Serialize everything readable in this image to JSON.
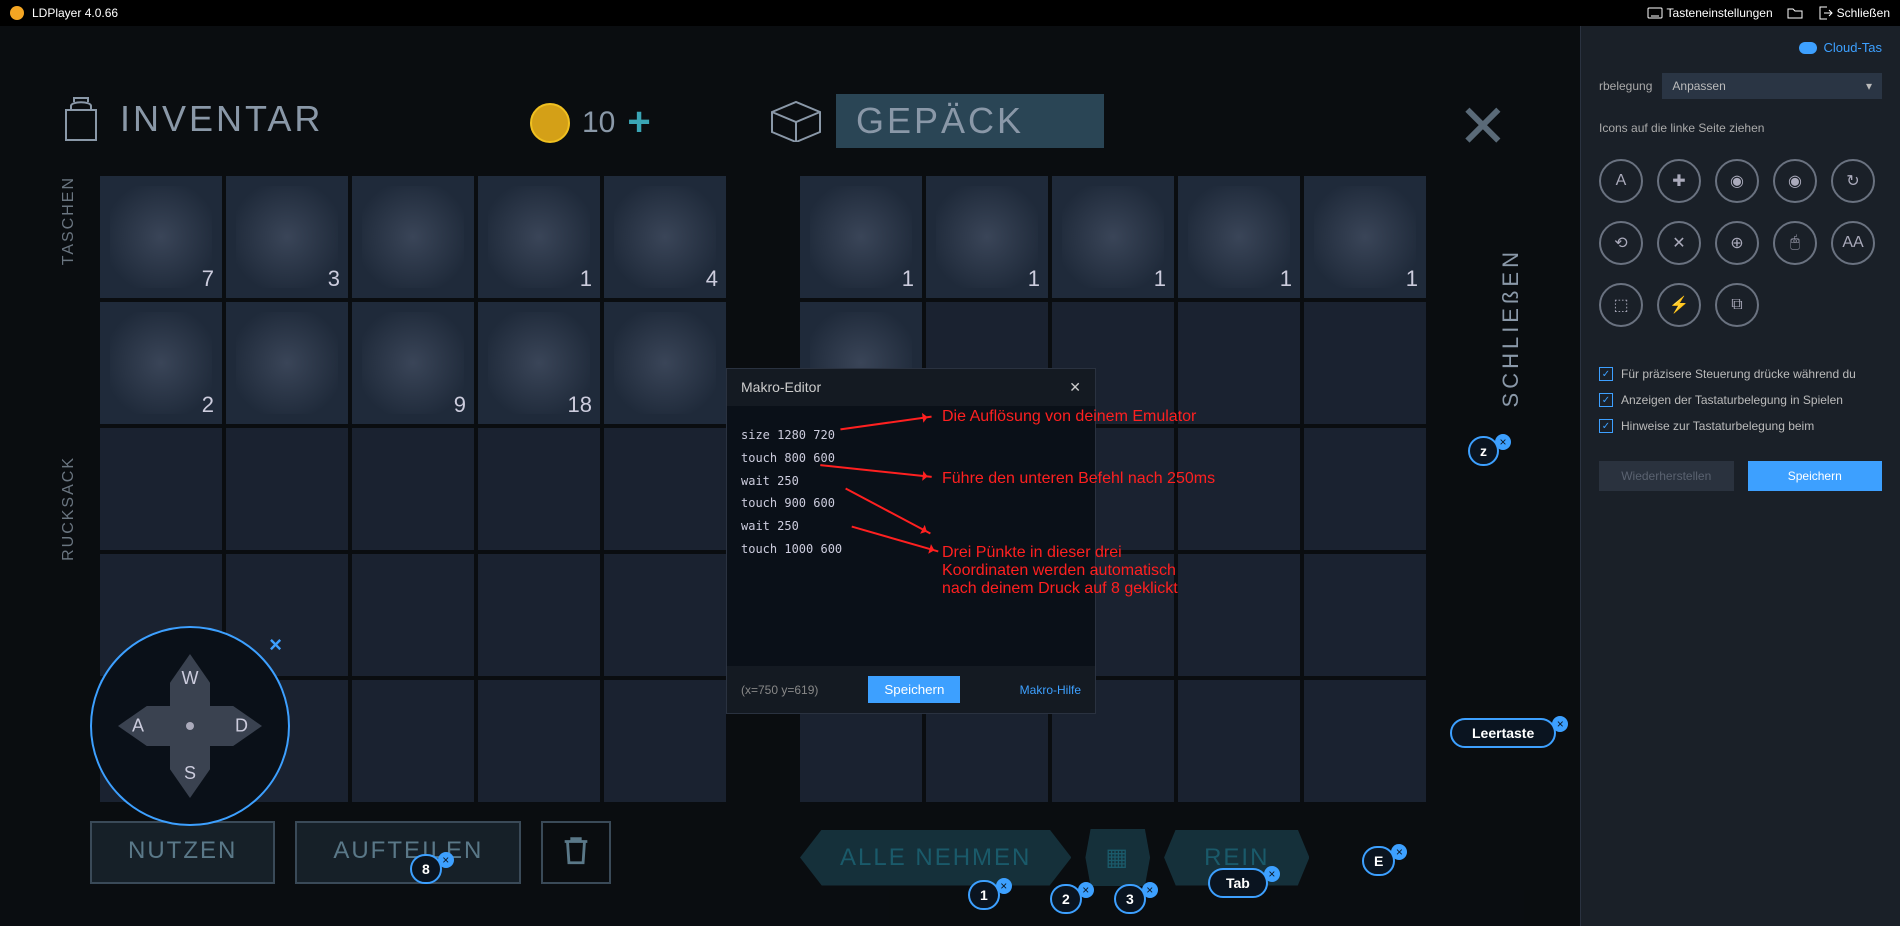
{
  "titlebar": {
    "app_name": "LDPlayer 4.0.66",
    "settings": "Tasteneinstellungen",
    "close": "Schließen"
  },
  "cloud_link": "Cloud-Tas",
  "dropdown": {
    "label": "rbelegung",
    "value": "Anpassen"
  },
  "hint": "Icons auf die linke Seite ziehen",
  "icons": [
    {
      "name": "key-a-icon",
      "glyph": "A"
    },
    {
      "name": "dpad-plus-icon",
      "glyph": "✚"
    },
    {
      "name": "fire-button-icon",
      "glyph": "◉"
    },
    {
      "name": "eye-view-icon",
      "glyph": "◉"
    },
    {
      "name": "gravity-sensor-icon",
      "glyph": "↻"
    },
    {
      "name": "swipe-icon",
      "glyph": "⟲"
    },
    {
      "name": "crosshair-swords-icon",
      "glyph": "✕"
    },
    {
      "name": "aim-icon",
      "glyph": "⊕"
    },
    {
      "name": "mouse-icon",
      "glyph": "🖱"
    },
    {
      "name": "text-aa-icon",
      "glyph": "AA"
    },
    {
      "name": "vibrate-icon",
      "glyph": "⬚"
    },
    {
      "name": "macro-lightning-icon",
      "glyph": "⚡"
    },
    {
      "name": "screenshot-icon",
      "glyph": "⧉"
    }
  ],
  "checkboxes": [
    "Für präzisere Steuerung drücke während du",
    "Anzeigen der Tastaturbelegung in Spielen",
    "Hinweise zur Tastaturbelegung beim"
  ],
  "panel_buttons": {
    "restore": "Wiederherstellen",
    "save": "Speichern"
  },
  "game": {
    "inventory_title": "INVENTAR",
    "gepack_title": "GEPÄCK",
    "coin_value": "10",
    "close_label": "SCHLIEßEN",
    "taschen": "TASCHEN",
    "rucksack": "RUCKSACK",
    "nutzen": "NUTZEN",
    "aufteilen": "AUFTEILEN",
    "alle_nehmen": "ALLE NEHMEN",
    "rein": "REIN"
  },
  "inv_counts": [
    "7",
    "3",
    "",
    "1",
    "4",
    "2",
    "",
    "9",
    "18",
    ""
  ],
  "gep_counts": [
    "1",
    "1",
    "1",
    "1",
    "1"
  ],
  "dpad": {
    "w": "W",
    "a": "A",
    "s": "S",
    "d": "D"
  },
  "key_badges": {
    "z": "z",
    "8": "8",
    "1": "1",
    "2": "2",
    "3": "3",
    "tab": "Tab",
    "e": "E",
    "space": "Leertaste"
  },
  "makro": {
    "title": "Makro-Editor",
    "lines": [
      "size  1280 720",
      "touch 800 600",
      "wait 250",
      "touch 900 600",
      "wait 250",
      "touch 1000 600"
    ],
    "coord": "(x=750  y=619)",
    "save": "Speichern",
    "help": "Makro-Hilfe"
  },
  "annotations": {
    "a1": "Die Auflösung von deinem Emulator",
    "a2": "Führe den unteren Befehl  nach 250ms",
    "a3": "Drei Pünkte in dieser drei\nKoordinaten werden automatisch\nnach deinem Druck auf 8 geklickt"
  }
}
